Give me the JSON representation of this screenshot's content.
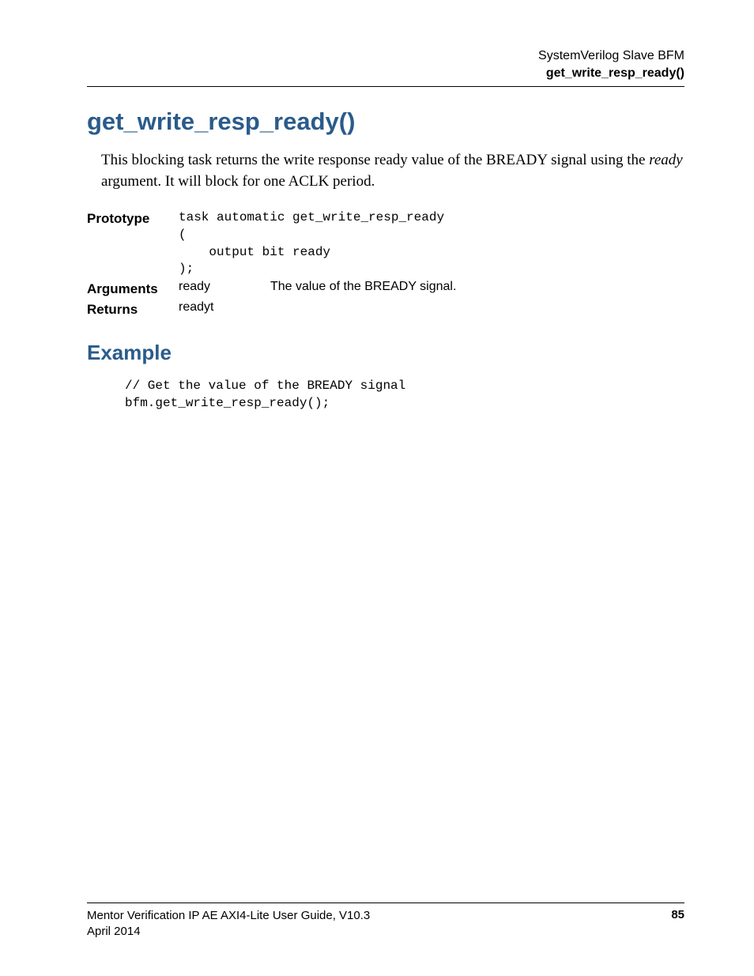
{
  "header": {
    "line1": "SystemVerilog Slave BFM",
    "line2": "get_write_resp_ready()"
  },
  "title": "get_write_resp_ready()",
  "description": {
    "part1": "This blocking task returns the write response ready value of the BREADY signal using the ",
    "italic": "ready",
    "part2": " argument. It will block for one ACLK period."
  },
  "definitions": {
    "prototype_label": "Prototype",
    "prototype_code": "task automatic get_write_resp_ready\n(\n    output bit ready\n);",
    "arguments_label": "Arguments",
    "arguments_name": "ready",
    "arguments_desc": "The value of the BREADY signal.",
    "returns_label": "Returns",
    "returns_value": "readyt"
  },
  "example": {
    "heading": "Example",
    "code": "// Get the value of the BREADY signal\nbfm.get_write_resp_ready();"
  },
  "footer": {
    "doc_title": "Mentor Verification IP AE AXI4-Lite User Guide, V10.3",
    "date": "April 2014",
    "page_number": "85"
  }
}
